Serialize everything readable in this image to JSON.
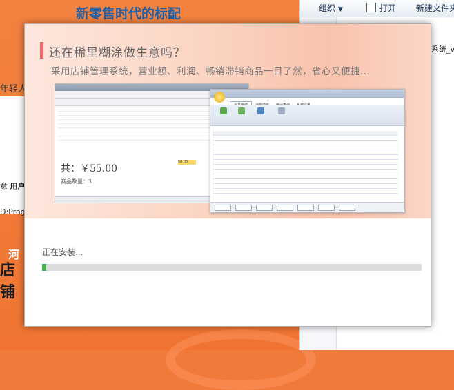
{
  "background_page": {
    "title": "新零售时代的标配",
    "fragment_1": "年轻人",
    "fragment_2_prefix": "意",
    "fragment_2_bold": "用户",
    "fragment_3": "D:Prog",
    "logo_text_1": "河",
    "logo_text_2": "店铺"
  },
  "explorer": {
    "organize": "组织",
    "open": "打开",
    "new_folder": "新建文件夹",
    "file_fragment": "系统_v"
  },
  "installer": {
    "headline": "还在稀里糊涂做生意吗？",
    "subline": "采用店铺管理系统，营业额、利润、畅销滞销商品一目了然，省心又便捷...",
    "preview": {
      "total": "共：￥55.00",
      "quantity": "商品数量：3",
      "amount_field": "50.00",
      "tabs": [
        "会员管理",
        "消费项目",
        "统计查询",
        "系统设置"
      ]
    },
    "status_text": "正在安装...",
    "progress": 0.01,
    "colors": {
      "accent_bar": "#f06a6a",
      "progress_fill": "#3fb44b",
      "progress_track": "#dcdcdc"
    }
  }
}
